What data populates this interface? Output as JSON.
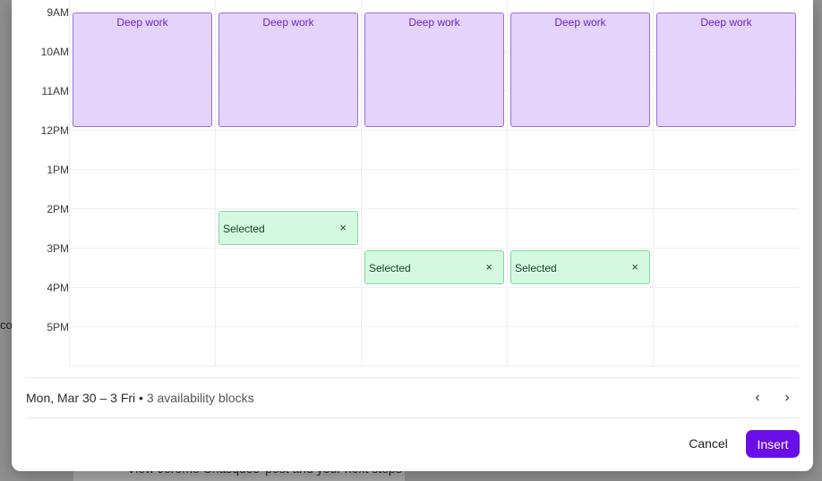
{
  "background": {
    "strip_text": "View Jerome Chasques' post and your next steps",
    "left_text": "co"
  },
  "times": [
    "9AM",
    "10AM",
    "11AM",
    "12PM",
    "1PM",
    "2PM",
    "3PM",
    "4PM",
    "5PM"
  ],
  "events": {
    "deep_work_label": "Deep work",
    "selected_label": "Selected",
    "close_glyph": "×"
  },
  "footer": {
    "range": "Mon, Mar 30 – 3 Fri",
    "separator": "•",
    "count": "3 availability blocks",
    "prev_glyph": "‹",
    "next_glyph": "›"
  },
  "actions": {
    "cancel_label": "Cancel",
    "insert_label": "Insert"
  },
  "colors": {
    "deep_work_bg": "#e4d3fb",
    "deep_work_border": "#9a6ee0",
    "deep_work_text": "#6d26c8",
    "selected_bg": "#d4f9e0",
    "selected_border": "#7fd99a",
    "primary": "#6a0ee8"
  }
}
